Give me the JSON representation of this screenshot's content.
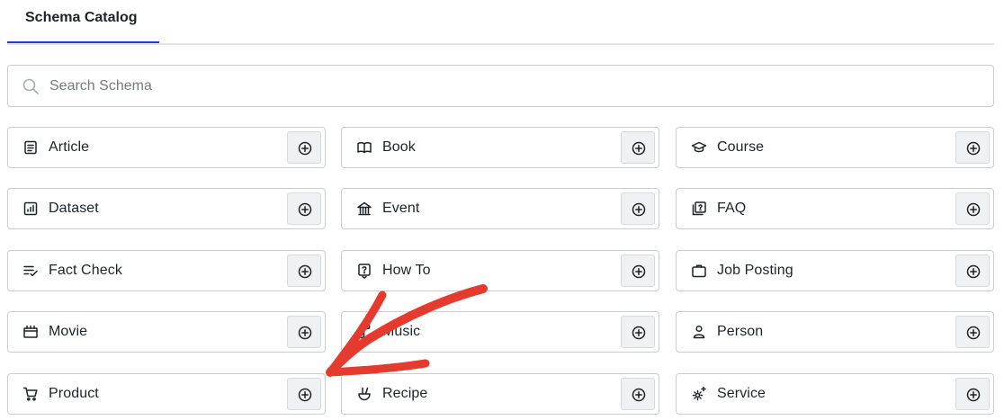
{
  "tabs": [
    {
      "label": "Schema Catalog",
      "active": true
    }
  ],
  "search": {
    "placeholder": "Search Schema",
    "value": "",
    "icon": "search-icon"
  },
  "colors": {
    "accent": "#1e3fc9",
    "annotation_arrow": "#e53a2e",
    "border": "#c9ccd1",
    "button_bg": "#f0f1f3"
  },
  "schemas": [
    {
      "label": "Article",
      "icon": "article-icon"
    },
    {
      "label": "Book",
      "icon": "book-icon"
    },
    {
      "label": "Course",
      "icon": "course-icon"
    },
    {
      "label": "Dataset",
      "icon": "dataset-icon"
    },
    {
      "label": "Event",
      "icon": "event-icon"
    },
    {
      "label": "FAQ",
      "icon": "faq-icon"
    },
    {
      "label": "Fact Check",
      "icon": "fact-check-icon"
    },
    {
      "label": "How To",
      "icon": "how-to-icon"
    },
    {
      "label": "Job Posting",
      "icon": "job-posting-icon"
    },
    {
      "label": "Movie",
      "icon": "movie-icon"
    },
    {
      "label": "Music",
      "icon": "music-icon"
    },
    {
      "label": "Person",
      "icon": "person-icon"
    },
    {
      "label": "Product",
      "icon": "product-icon"
    },
    {
      "label": "Recipe",
      "icon": "recipe-icon"
    },
    {
      "label": "Service",
      "icon": "service-icon"
    }
  ],
  "add_button_icon": "plus-circle-icon",
  "annotation": {
    "type": "arrow",
    "points_to": "Product"
  }
}
